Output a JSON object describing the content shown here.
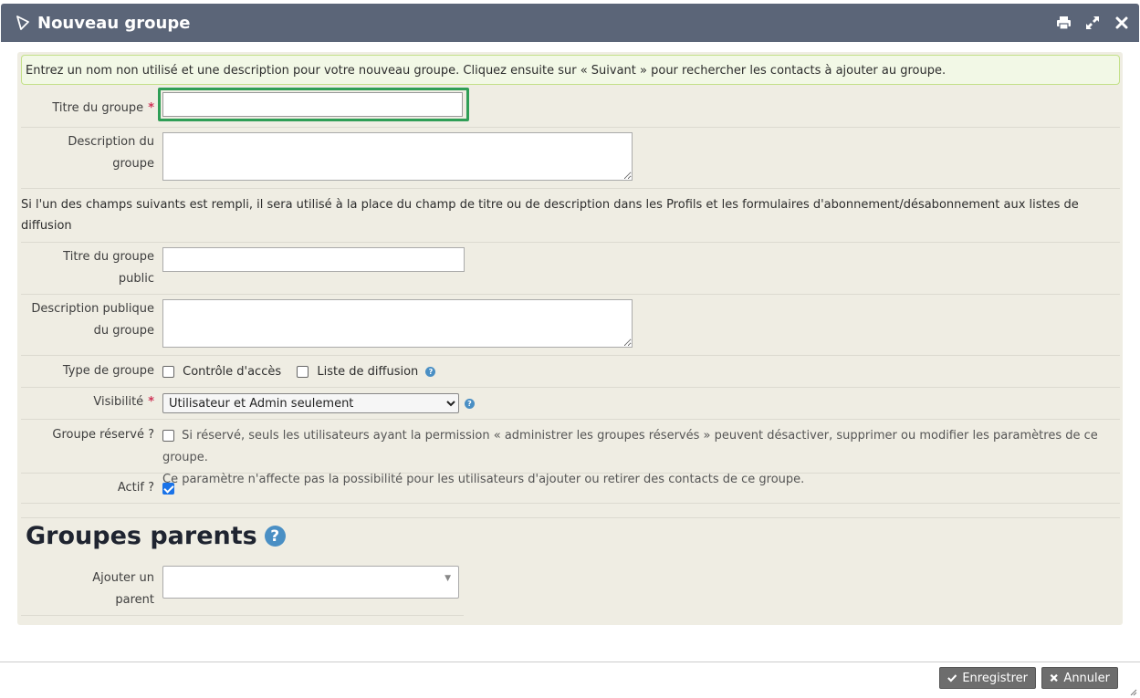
{
  "dialog": {
    "title": "Nouveau groupe"
  },
  "help": "Entrez un nom non utilisé et une description pour votre nouveau groupe. Cliquez ensuite sur « Suivant » pour rechercher les contacts à ajouter au groupe.",
  "form": {
    "title_label": "Titre du groupe",
    "required": "*",
    "description_label_1": "Description du",
    "description_label_2": "groupe",
    "override_note": "Si l'un des champs suivants est rempli, il sera utilisé à la place du champ de titre ou de description dans les Profils et les formulaires d'abonnement/désabonnement aux listes de diffusion",
    "public_title_label_1": "Titre du groupe",
    "public_title_label_2": "public",
    "public_desc_label_1": "Description publique",
    "public_desc_label_2": "du groupe",
    "type_label": "Type de groupe",
    "type_access": "Contrôle d'accès",
    "type_mailing": "Liste de diffusion",
    "visibility_label": "Visibilité",
    "visibility_value": "Utilisateur et Admin seulement",
    "reserved_label": "Groupe réservé ?",
    "reserved_text_1": "Si réservé, seuls les utilisateurs ayant la permission « administrer les groupes réservés » peuvent désactiver, supprimer ou modifier les paramètres de ce groupe.",
    "reserved_text_2": "Ce paramètre n'affecte pas la possibilité pour les utilisateurs d'ajouter ou retirer des contacts de ce groupe.",
    "active_label": "Actif ?"
  },
  "parents": {
    "heading": "Groupes parents",
    "add_label_1": "Ajouter un",
    "add_label_2": "parent"
  },
  "buttons": {
    "save": "Enregistrer",
    "cancel": "Annuler"
  },
  "icons": [
    "civi-logo-icon",
    "print-icon",
    "maximize-icon",
    "close-icon",
    "help-icon",
    "check-icon",
    "times-icon"
  ]
}
